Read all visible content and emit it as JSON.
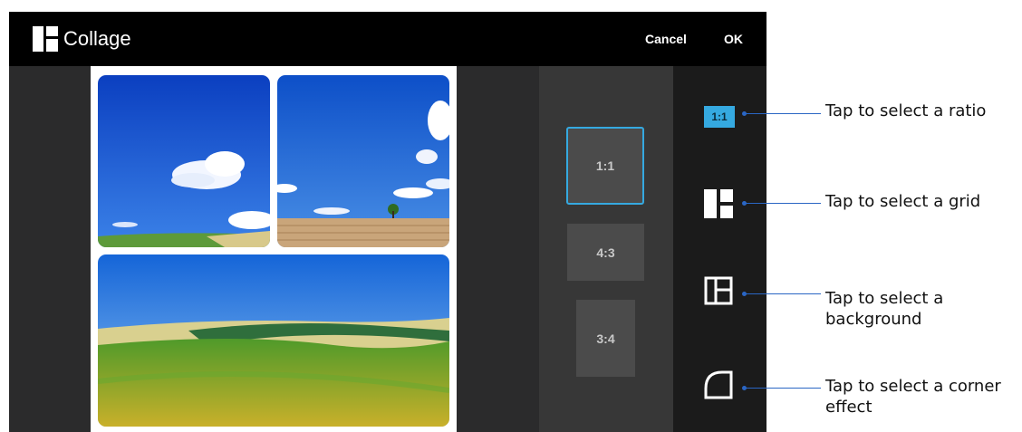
{
  "app": {
    "title": "Collage",
    "icon": "collage-icon"
  },
  "toolbar": {
    "cancel_label": "Cancel",
    "ok_label": "OK"
  },
  "ratios": [
    {
      "label": "1:1",
      "selected": true
    },
    {
      "label": "4:3",
      "selected": false
    },
    {
      "label": "3:4",
      "selected": false
    }
  ],
  "tools": {
    "ratio_label": "1:1",
    "icons": [
      "ratio-icon",
      "grid-icon",
      "background-icon",
      "corner-effect-icon"
    ]
  },
  "callouts": [
    {
      "text": "Tap to select a ratio"
    },
    {
      "text": "Tap to select a grid"
    },
    {
      "text": "Tap to select a background"
    },
    {
      "text": "Tap to select a corner effect"
    }
  ],
  "colors": {
    "accent": "#35a9e0",
    "callout_line": "#2a66c4",
    "topbar": "#000000"
  }
}
